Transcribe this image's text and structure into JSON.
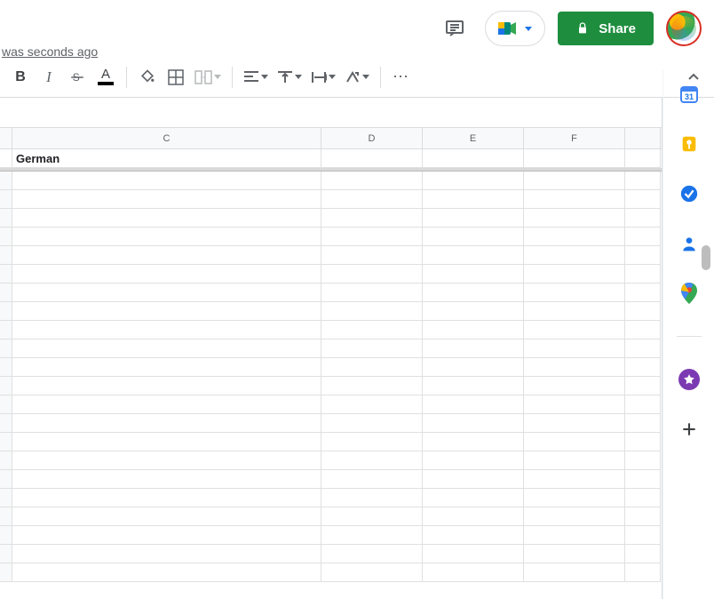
{
  "header": {
    "last_edit_text": "was seconds ago",
    "share_label": "Share"
  },
  "toolbar": {
    "bold_glyph": "B",
    "more_glyph": "⋯"
  },
  "columns": {
    "C": "C",
    "D": "D",
    "E": "E",
    "F": "F"
  },
  "cells": {
    "C1": "German"
  },
  "sidepanel": {
    "calendar_day": "31"
  }
}
